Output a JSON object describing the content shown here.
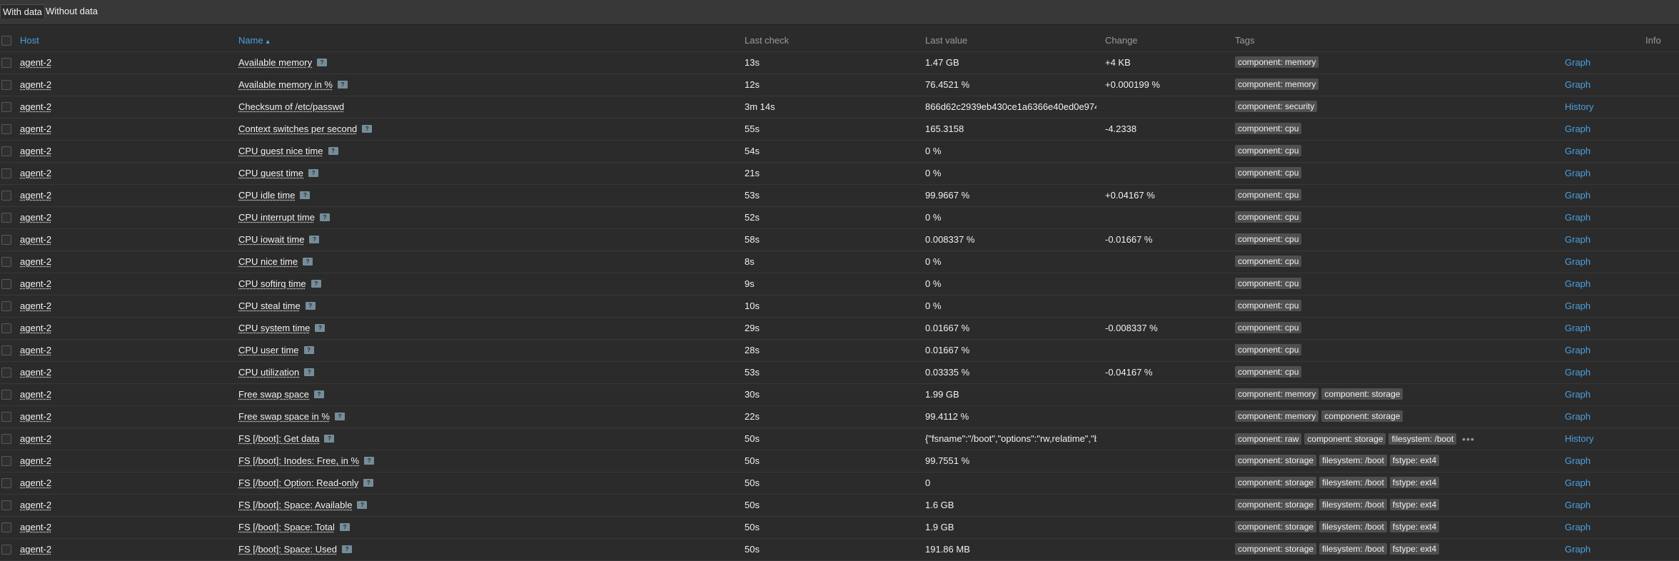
{
  "filter_tabs": {
    "with_data": "With data",
    "without_data": "Without data"
  },
  "columns": {
    "host": "Host",
    "name": "Name",
    "sort_indicator": "▲",
    "last_check": "Last check",
    "last_value": "Last value",
    "change": "Change",
    "tags": "Tags",
    "info": "Info"
  },
  "help_glyph": "?",
  "more_glyph": "•••",
  "rows": [
    {
      "host": "agent-2",
      "name": "Available memory",
      "help": true,
      "last_check": "13s",
      "last_value": "1.47 GB",
      "change": "+4 KB",
      "tags": [
        "component: memory"
      ],
      "action": "Graph"
    },
    {
      "host": "agent-2",
      "name": "Available memory in %",
      "help": true,
      "last_check": "12s",
      "last_value": "76.4521 %",
      "change": "+0.000199 %",
      "tags": [
        "component: memory"
      ],
      "action": "Graph"
    },
    {
      "host": "agent-2",
      "name": "Checksum of /etc/passwd",
      "help": false,
      "last_check": "3m 14s",
      "last_value": "866d62c2939eb430ce1a6366e40ed0e974...",
      "change": "",
      "tags": [
        "component: security"
      ],
      "action": "History"
    },
    {
      "host": "agent-2",
      "name": "Context switches per second",
      "help": true,
      "last_check": "55s",
      "last_value": "165.3158",
      "change": "-4.2338",
      "tags": [
        "component: cpu"
      ],
      "action": "Graph"
    },
    {
      "host": "agent-2",
      "name": "CPU guest nice time",
      "help": true,
      "last_check": "54s",
      "last_value": "0 %",
      "change": "",
      "tags": [
        "component: cpu"
      ],
      "action": "Graph"
    },
    {
      "host": "agent-2",
      "name": "CPU guest time",
      "help": true,
      "last_check": "21s",
      "last_value": "0 %",
      "change": "",
      "tags": [
        "component: cpu"
      ],
      "action": "Graph"
    },
    {
      "host": "agent-2",
      "name": "CPU idle time",
      "help": true,
      "last_check": "53s",
      "last_value": "99.9667 %",
      "change": "+0.04167 %",
      "tags": [
        "component: cpu"
      ],
      "action": "Graph"
    },
    {
      "host": "agent-2",
      "name": "CPU interrupt time",
      "help": true,
      "last_check": "52s",
      "last_value": "0 %",
      "change": "",
      "tags": [
        "component: cpu"
      ],
      "action": "Graph"
    },
    {
      "host": "agent-2",
      "name": "CPU iowait time",
      "help": true,
      "last_check": "58s",
      "last_value": "0.008337 %",
      "change": "-0.01667 %",
      "tags": [
        "component: cpu"
      ],
      "action": "Graph"
    },
    {
      "host": "agent-2",
      "name": "CPU nice time",
      "help": true,
      "last_check": "8s",
      "last_value": "0 %",
      "change": "",
      "tags": [
        "component: cpu"
      ],
      "action": "Graph"
    },
    {
      "host": "agent-2",
      "name": "CPU softirq time",
      "help": true,
      "last_check": "9s",
      "last_value": "0 %",
      "change": "",
      "tags": [
        "component: cpu"
      ],
      "action": "Graph"
    },
    {
      "host": "agent-2",
      "name": "CPU steal time",
      "help": true,
      "last_check": "10s",
      "last_value": "0 %",
      "change": "",
      "tags": [
        "component: cpu"
      ],
      "action": "Graph"
    },
    {
      "host": "agent-2",
      "name": "CPU system time",
      "help": true,
      "last_check": "29s",
      "last_value": "0.01667 %",
      "change": "-0.008337 %",
      "tags": [
        "component: cpu"
      ],
      "action": "Graph"
    },
    {
      "host": "agent-2",
      "name": "CPU user time",
      "help": true,
      "last_check": "28s",
      "last_value": "0.01667 %",
      "change": "",
      "tags": [
        "component: cpu"
      ],
      "action": "Graph"
    },
    {
      "host": "agent-2",
      "name": "CPU utilization",
      "help": true,
      "last_check": "53s",
      "last_value": "0.03335 %",
      "change": "-0.04167 %",
      "tags": [
        "component: cpu"
      ],
      "action": "Graph"
    },
    {
      "host": "agent-2",
      "name": "Free swap space",
      "help": true,
      "last_check": "30s",
      "last_value": "1.99 GB",
      "change": "",
      "tags": [
        "component: memory",
        "component: storage"
      ],
      "action": "Graph"
    },
    {
      "host": "agent-2",
      "name": "Free swap space in %",
      "help": true,
      "last_check": "22s",
      "last_value": "99.4112 %",
      "change": "",
      "tags": [
        "component: memory",
        "component: storage"
      ],
      "action": "Graph"
    },
    {
      "host": "agent-2",
      "name": "FS [/boot]: Get data",
      "help": true,
      "last_check": "50s",
      "last_value": "{\"fsname\":\"/boot\",\"options\":\"rw,relatime\",\"b...",
      "change": "",
      "tags": [
        "component: raw",
        "component: storage",
        "filesystem: /boot"
      ],
      "more": true,
      "action": "History"
    },
    {
      "host": "agent-2",
      "name": "FS [/boot]: Inodes: Free, in %",
      "help": true,
      "last_check": "50s",
      "last_value": "99.7551 %",
      "change": "",
      "tags": [
        "component: storage",
        "filesystem: /boot",
        "fstype: ext4"
      ],
      "action": "Graph"
    },
    {
      "host": "agent-2",
      "name": "FS [/boot]: Option: Read-only",
      "help": true,
      "last_check": "50s",
      "last_value": "0",
      "change": "",
      "tags": [
        "component: storage",
        "filesystem: /boot",
        "fstype: ext4"
      ],
      "action": "Graph"
    },
    {
      "host": "agent-2",
      "name": "FS [/boot]: Space: Available",
      "help": true,
      "last_check": "50s",
      "last_value": "1.6 GB",
      "change": "",
      "tags": [
        "component: storage",
        "filesystem: /boot",
        "fstype: ext4"
      ],
      "action": "Graph"
    },
    {
      "host": "agent-2",
      "name": "FS [/boot]: Space: Total",
      "help": true,
      "last_check": "50s",
      "last_value": "1.9 GB",
      "change": "",
      "tags": [
        "component: storage",
        "filesystem: /boot",
        "fstype: ext4"
      ],
      "action": "Graph"
    },
    {
      "host": "agent-2",
      "name": "FS [/boot]: Space: Used",
      "help": true,
      "last_check": "50s",
      "last_value": "191.86 MB",
      "change": "",
      "tags": [
        "component: storage",
        "filesystem: /boot",
        "fstype: ext4"
      ],
      "action": "Graph"
    }
  ]
}
